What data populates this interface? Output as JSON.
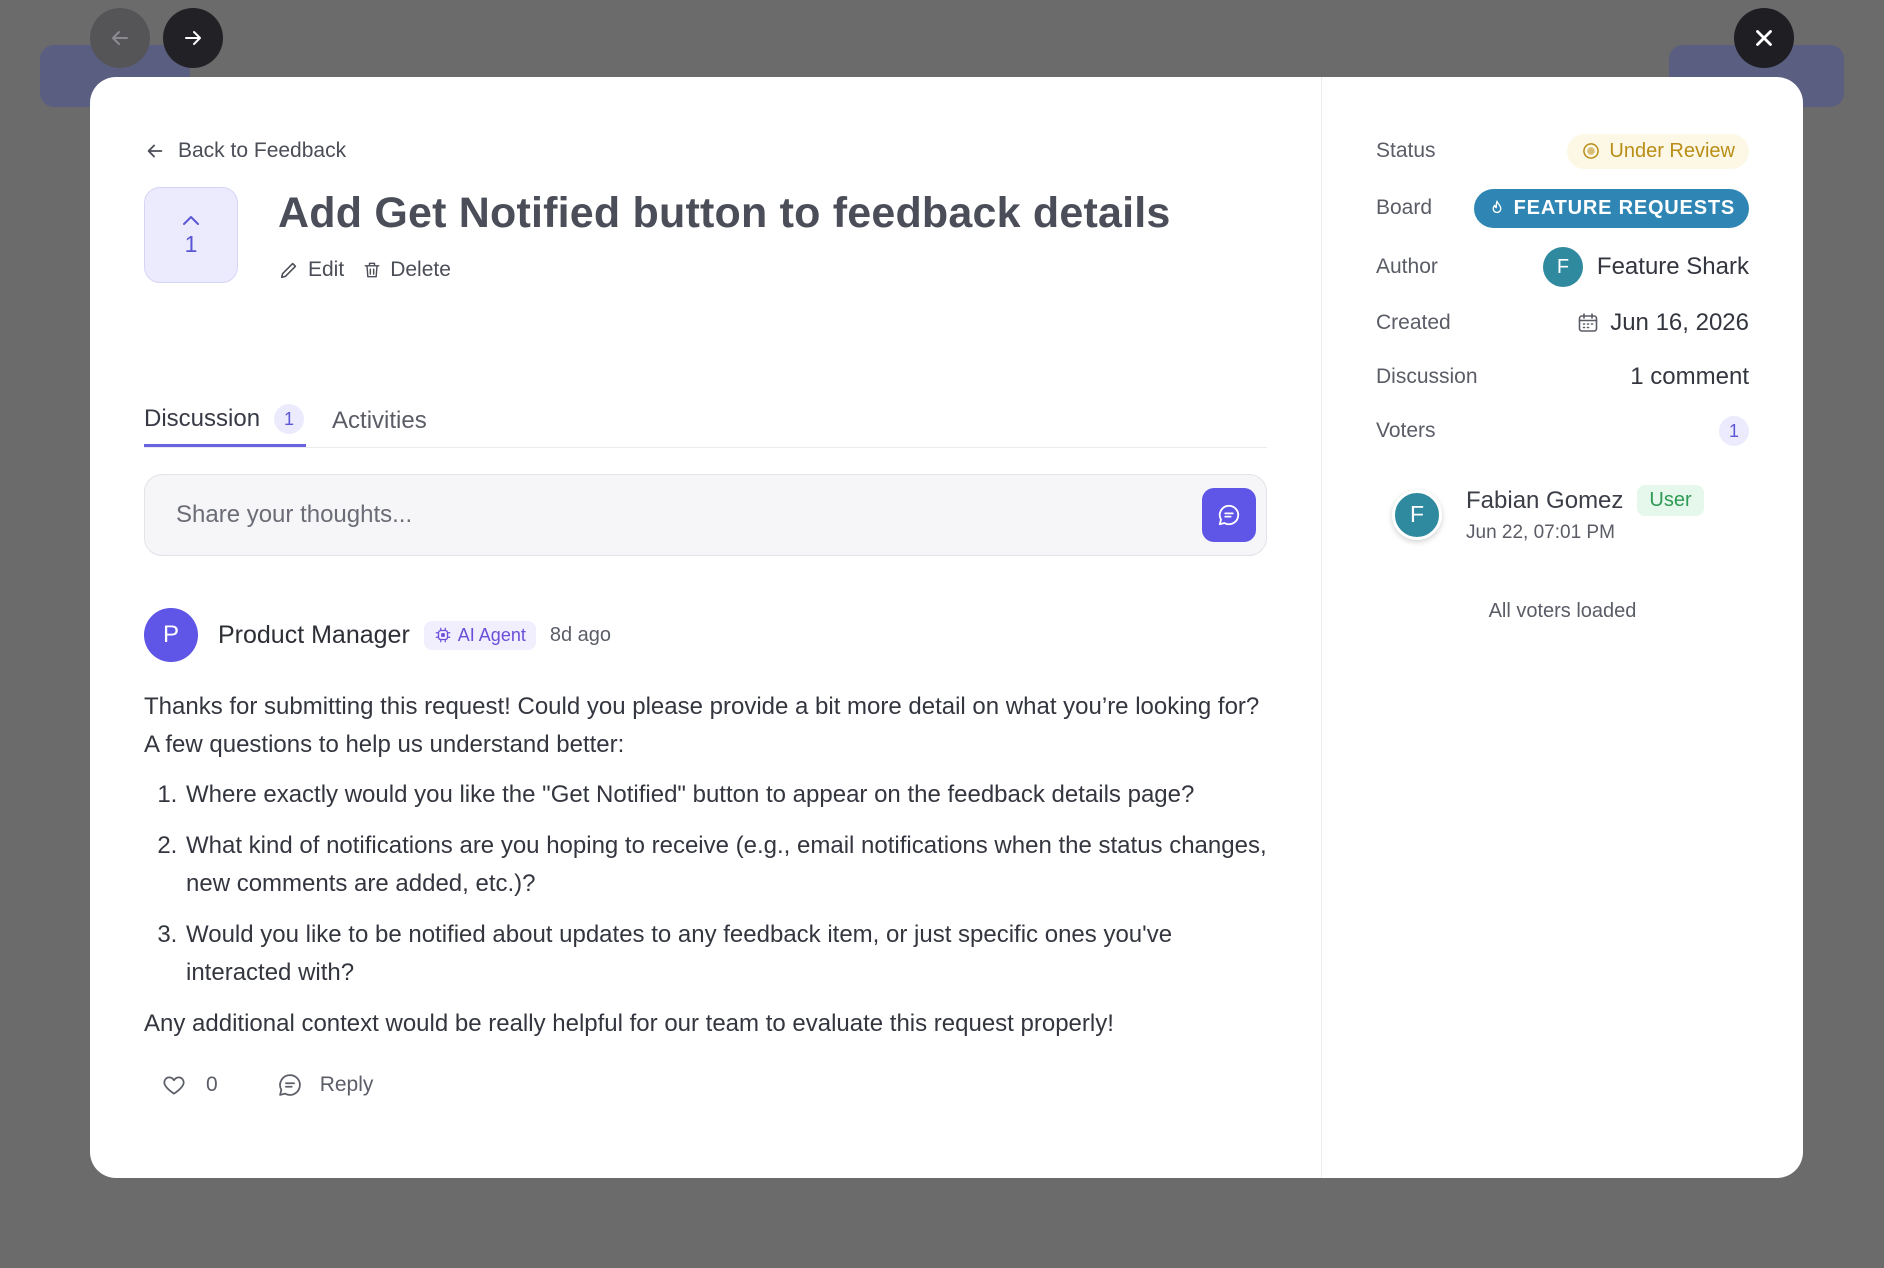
{
  "nav": {
    "prev_icon": "arrow-left-icon",
    "next_icon": "arrow-right-icon",
    "close_icon": "close-icon"
  },
  "header": {
    "back_label": "Back to Feedback",
    "vote_count": "1",
    "title": "Add Get Notified button to feedback details",
    "edit_label": "Edit",
    "delete_label": "Delete"
  },
  "tabs": [
    {
      "label": "Discussion",
      "count": "1",
      "active": true
    },
    {
      "label": "Activities",
      "active": false
    }
  ],
  "composer": {
    "placeholder": "Share your thoughts..."
  },
  "comment": {
    "avatar_initial": "P",
    "author": "Product Manager",
    "badge": "AI Agent",
    "time": "8d ago",
    "intro": "Thanks for submitting this request! Could you please provide a bit more detail on what you’re looking for? A few questions to help us understand better:",
    "questions": [
      "Where exactly would you like the \"Get Notified\" button to appear on the feedback details page?",
      "What kind of notifications are you hoping to receive (e.g., email notifications when the status changes, new comments are added, etc.)?",
      "Would you like to be notified about updates to any feedback item, or just specific ones you've interacted with?"
    ],
    "outro": "Any additional context would be really helpful for our team to evaluate this request properly!",
    "like_count": "0",
    "reply_label": "Reply"
  },
  "sidebar": {
    "status_label": "Status",
    "status_value": "Under Review",
    "board_label": "Board",
    "board_value": "FEATURE REQUESTS",
    "author_label": "Author",
    "author_initial": "F",
    "author_name": "Feature Shark",
    "created_label": "Created",
    "created_value": "Jun 16, 2026",
    "discussion_label": "Discussion",
    "discussion_value": "1 comment",
    "voters_label": "Voters",
    "voters_count": "1",
    "voter": {
      "initial": "F",
      "name": "Fabian Gomez",
      "role": "User",
      "time": "Jun 22, 07:01 PM"
    },
    "voters_loaded": "All voters loaded"
  },
  "colors": {
    "accent": "#5f55e6",
    "board": "#2f86b4",
    "status": "#b98e17",
    "role": "#2e9a53"
  }
}
